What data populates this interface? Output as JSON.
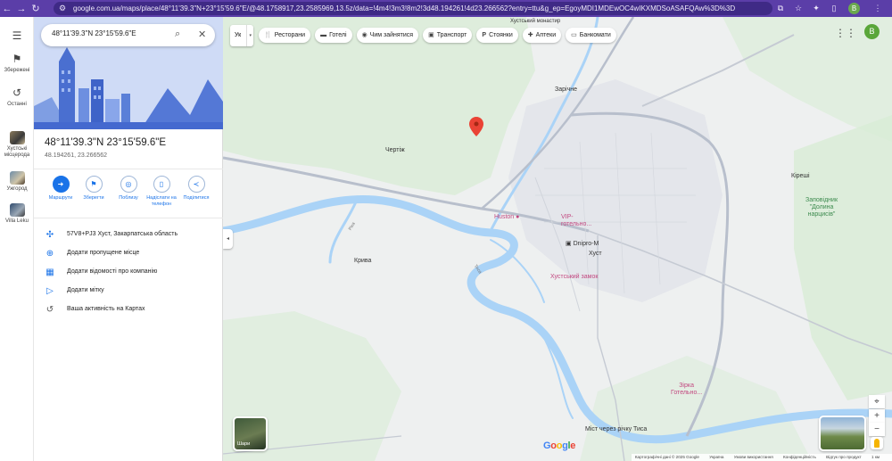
{
  "browser": {
    "url": "google.com.ua/maps/place/48°11'39.3\"N+23°15'59.6\"E/@48.1758917,23.2585969,13.5z/data=!4m4!3m3!8m2!3d48.194261!4d23.266562?entry=ttu&g_ep=EgoyMDI1MDEwOC4wIKXMDSoASAFQAw%3D%3D",
    "profile_initial": "B"
  },
  "rail": {
    "saved": "Збережені",
    "recent": "Останні",
    "items": [
      {
        "label": "Хустські місцерода"
      },
      {
        "label": "Ужгород"
      },
      {
        "label": "Villa Leku"
      }
    ]
  },
  "search": {
    "value": "48°11'39.3\"N 23°15'59.6\"E"
  },
  "place": {
    "title": "48°11'39.3\"N 23°15'59.6\"E",
    "decimal": "48.194261, 23.266562"
  },
  "actions": [
    {
      "label": "Маршрути"
    },
    {
      "label": "Зберегти"
    },
    {
      "label": "Поблизу"
    },
    {
      "label": "Надіслати на телефон"
    },
    {
      "label": "Поділитися"
    }
  ],
  "info": {
    "plus_code": "57V8+PJ3 Хуст, Закарпатська область",
    "add_missing": "Додати пропущене місце",
    "add_business": "Додати відомості про компанію",
    "add_label": "Додати мітку",
    "activity": "Ваша активність на Картах"
  },
  "chips": {
    "lang": "Ук",
    "items": [
      "Ресторани",
      "Готелі",
      "Чим зайнятися",
      "Транспорт",
      "Стоянки",
      "Аптеки",
      "Банкомати"
    ]
  },
  "map_labels": {
    "zarichne": "Зарічне",
    "chertizh": "Чертіж",
    "kireshi": "Кіреші",
    "kryva": "Крива",
    "khust": "Хуст",
    "huston": "Huston",
    "vip": "VIP-\nготельно...",
    "dnipro": "Dnipro-M",
    "castle": "Хустський замок",
    "zirka": "Зірка\nГотельно...",
    "reserve": "Заповідник\n\"Долина\nнарцисів\"",
    "bridge": "Міст через річку Тиса",
    "monastery": "Хустський монастир",
    "river_tysa": "Тиса",
    "river_rika": "Ріка",
    "layers": "Шари"
  },
  "attribution": {
    "data": "Картографічні дані © 2025 Google",
    "country": "Україна",
    "terms": "Умови використання",
    "privacy": "Конфіденційність",
    "feedback": "Відгук про продукт",
    "scale": "1 км"
  },
  "colors": {
    "chrome": "#5b3ea8",
    "accent": "#1a73e8",
    "water": "#aad3f7",
    "pin": "#ea4335"
  }
}
